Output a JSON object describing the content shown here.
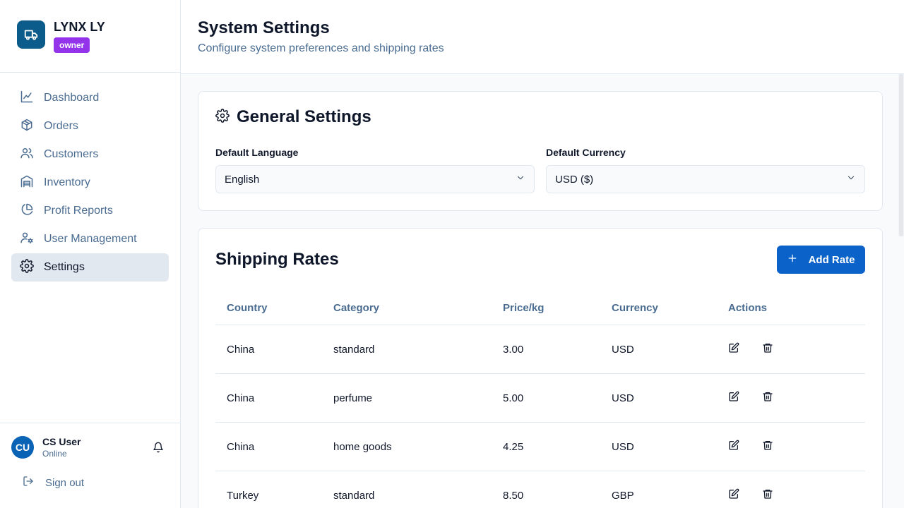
{
  "brand": {
    "name": "LYNX LY",
    "role": "owner",
    "logo_icon": "truck-icon",
    "logo_color": "#0b5c8a"
  },
  "nav": [
    {
      "label": "Dashboard",
      "icon": "line-chart-icon",
      "active": false
    },
    {
      "label": "Orders",
      "icon": "package-icon",
      "active": false
    },
    {
      "label": "Customers",
      "icon": "users-icon",
      "active": false
    },
    {
      "label": "Inventory",
      "icon": "warehouse-icon",
      "active": false
    },
    {
      "label": "Profit Reports",
      "icon": "pie-chart-icon",
      "active": false
    },
    {
      "label": "User Management",
      "icon": "user-cog-icon",
      "active": false
    },
    {
      "label": "Settings",
      "icon": "gear-icon",
      "active": true
    }
  ],
  "user": {
    "initials": "CU",
    "name": "CS User",
    "status": "Online"
  },
  "signout_label": "Sign out",
  "header": {
    "title": "System Settings",
    "subtitle": "Configure system preferences and shipping rates"
  },
  "general": {
    "title": "General Settings",
    "language_label": "Default Language",
    "language_value": "English",
    "currency_label": "Default Currency",
    "currency_value": "USD ($)"
  },
  "rates": {
    "title": "Shipping Rates",
    "add_label": "Add Rate",
    "columns": [
      "Country",
      "Category",
      "Price/kg",
      "Currency",
      "Actions"
    ],
    "rows": [
      {
        "country": "China",
        "category": "standard",
        "price": "3.00",
        "currency": "USD"
      },
      {
        "country": "China",
        "category": "perfume",
        "price": "5.00",
        "currency": "USD"
      },
      {
        "country": "China",
        "category": "home goods",
        "price": "4.25",
        "currency": "USD"
      },
      {
        "country": "Turkey",
        "category": "standard",
        "price": "8.50",
        "currency": "GBP"
      }
    ]
  },
  "colors": {
    "accent": "#0b63c9",
    "role_badge": "#9333ea",
    "muted_text": "#4a6c91"
  }
}
